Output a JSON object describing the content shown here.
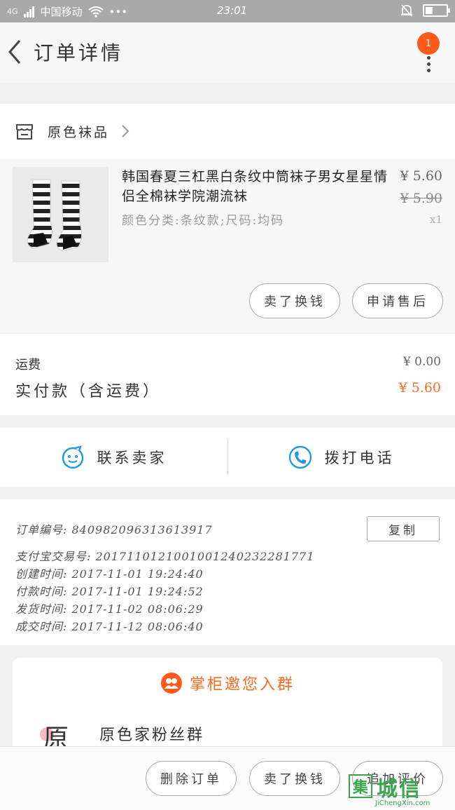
{
  "status_bar": {
    "signal": "4G",
    "carrier": "中国移动",
    "extra": "•••",
    "time": "23:01"
  },
  "header": {
    "title": "订单详情",
    "badge_count": "1"
  },
  "store": {
    "name": "原色袜品"
  },
  "item": {
    "title": "韩国春夏三杠黑白条纹中筒袜子男女星星情侣全棉袜学院潮流袜",
    "spec": "颜色分类:条纹款;尺码:均码",
    "price": "¥ 5.60",
    "original_price": "¥ 5.90",
    "quantity": "x1",
    "actions": [
      "卖了换钱",
      "申请售后"
    ]
  },
  "fees": {
    "shipping_label": "运费",
    "shipping_value": "¥ 0.00",
    "paid_label": "实付款（含运费）",
    "paid_value": "¥ 5.60",
    "accent_color": "#ff6a1f"
  },
  "contact": {
    "seller_label": "联系卖家",
    "call_label": "拨打电话",
    "icon_color": "#1e9be0"
  },
  "order_info": {
    "copy_label": "复制",
    "order_no": "订单编号:  840982096313613917",
    "alipay_no": "支付宝交易号:  2017110121001001240232281771",
    "created": "创建时间:  2017-11-01 19:24:40",
    "paid": "付款时间:  2017-11-01 19:24:52",
    "shipped": "发货时间:  2017-11-02 08:06:29",
    "completed": "成交时间:  2017-11-12 08:06:40"
  },
  "group": {
    "invite_text": "掌柜邀您入群",
    "avatar_char": "原",
    "name": "原色家粉丝群"
  },
  "bottom_actions": [
    "删除订单",
    "卖了换钱",
    "追加评价"
  ],
  "watermark": {
    "logo_char": "集",
    "text": "城信",
    "url": "JiChengXin.com"
  }
}
